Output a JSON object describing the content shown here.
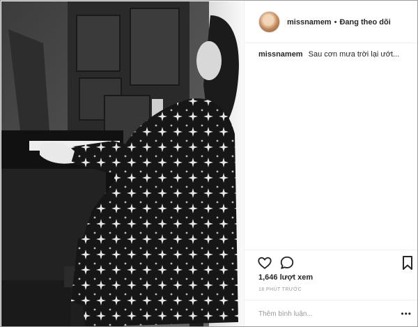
{
  "post": {
    "image_alt": "",
    "author": {
      "username": "missnamem",
      "follow_status": "Đang theo dõi",
      "separator": "•",
      "avatar_icon": "avatar-photo"
    },
    "caption": {
      "username": "missnamem",
      "text": "Sau cơn mưa trời lại ướt..."
    },
    "actions": {
      "like_icon": "heart-outline-icon",
      "comment_icon": "speech-bubble-icon",
      "save_icon": "bookmark-outline-icon"
    },
    "views": "1,646 lượt xem",
    "timestamp": "18 PHÚT TRƯỚC",
    "comment_box": {
      "placeholder": "Thêm bình luận...",
      "more_label": "•••"
    }
  },
  "colors": {
    "text": "#262626",
    "muted": "#999999",
    "divider": "#efefef",
    "frame": "#9a9a9a"
  }
}
